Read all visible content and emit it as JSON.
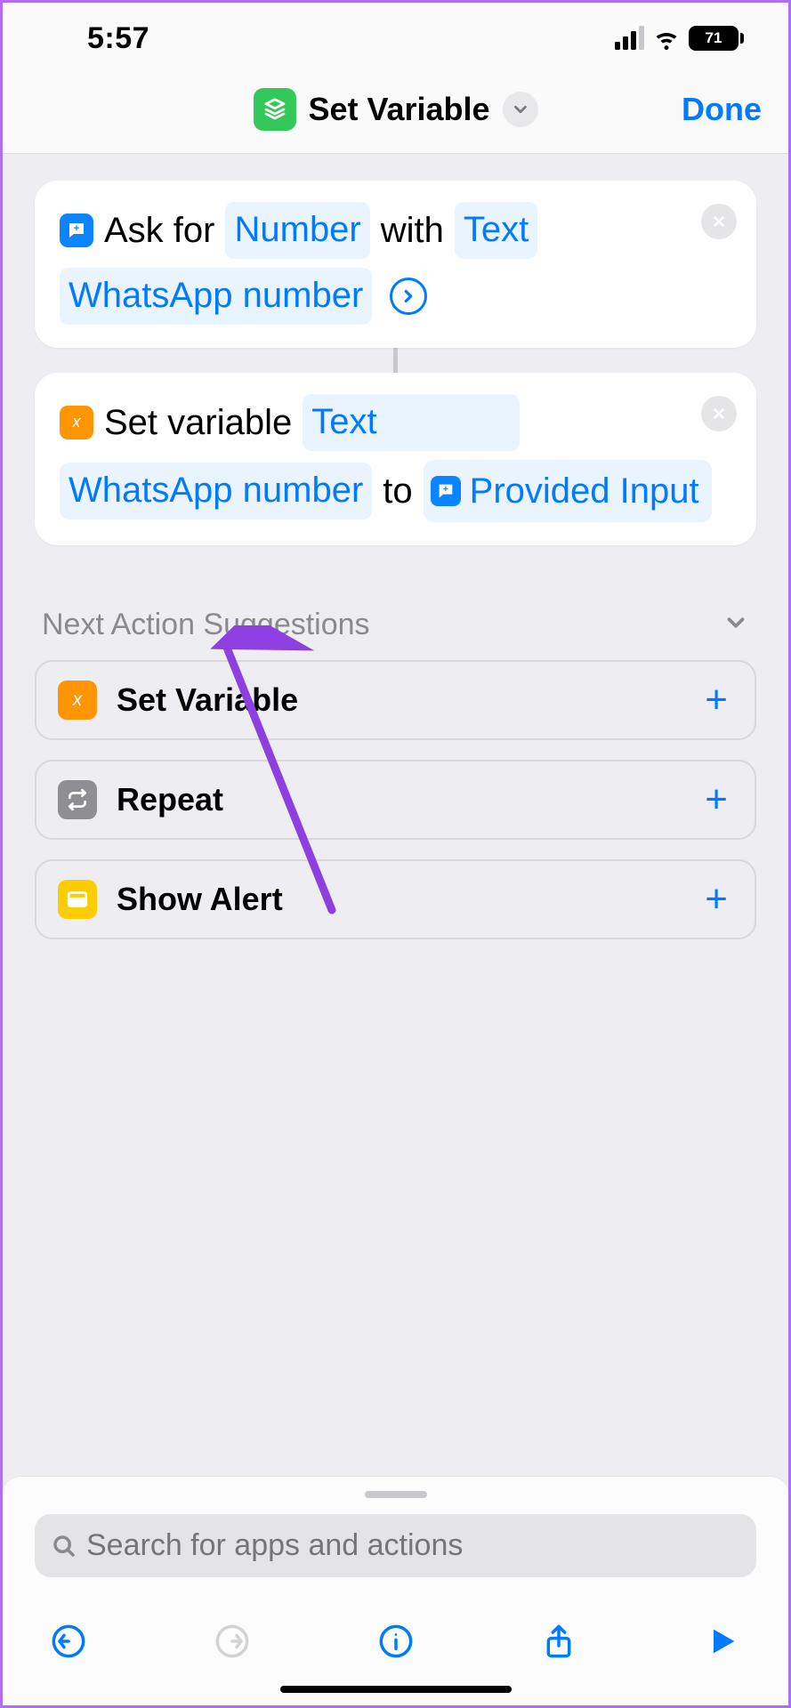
{
  "status": {
    "time": "5:57",
    "battery": "71"
  },
  "nav": {
    "title": "Set Variable",
    "done": "Done"
  },
  "actions": {
    "ask": {
      "prefix": "Ask for",
      "param1": "Number",
      "mid": "with",
      "param2": "Text",
      "line2": "WhatsApp number"
    },
    "setvar": {
      "prefix": "Set variable",
      "param1": "Text",
      "line2": "WhatsApp number",
      "mid": "to",
      "input": "Provided Input"
    }
  },
  "suggestions": {
    "title": "Next Action Suggestions",
    "items": [
      {
        "label": "Set Variable",
        "icon": "orange-x"
      },
      {
        "label": "Repeat",
        "icon": "gray-repeat"
      },
      {
        "label": "Show Alert",
        "icon": "yellow-window"
      }
    ]
  },
  "search": {
    "placeholder": "Search for apps and actions"
  }
}
